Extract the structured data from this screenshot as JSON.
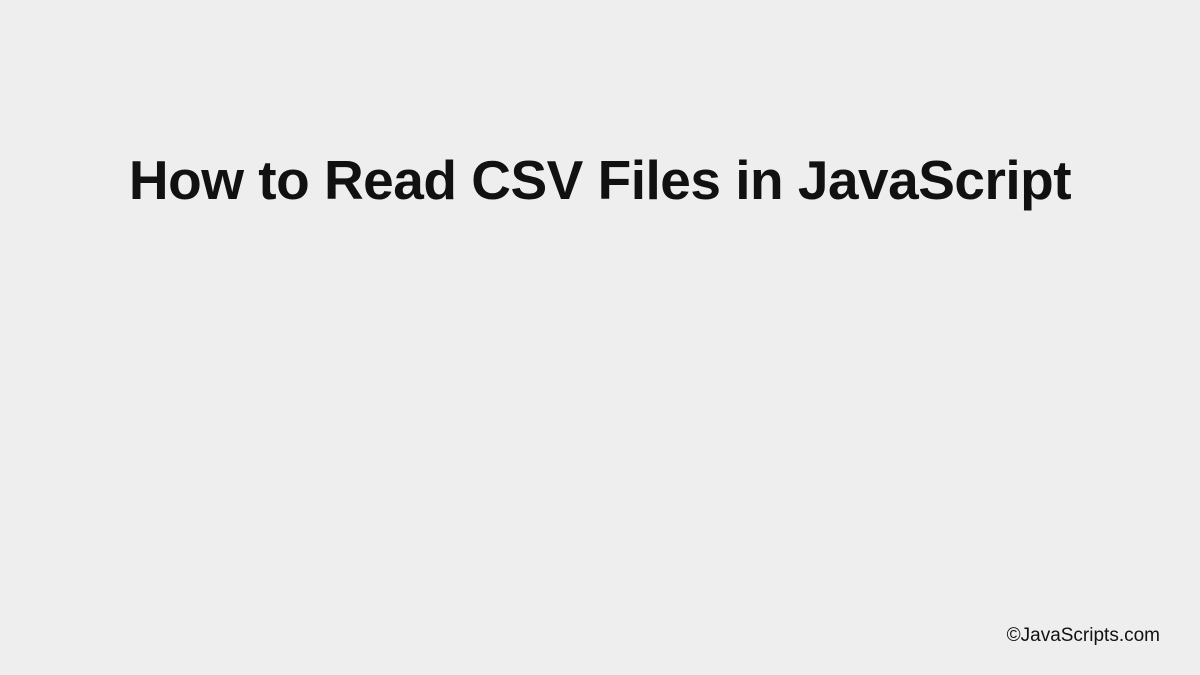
{
  "title": "How to Read CSV Files in JavaScript",
  "attribution": "©JavaScripts.com"
}
